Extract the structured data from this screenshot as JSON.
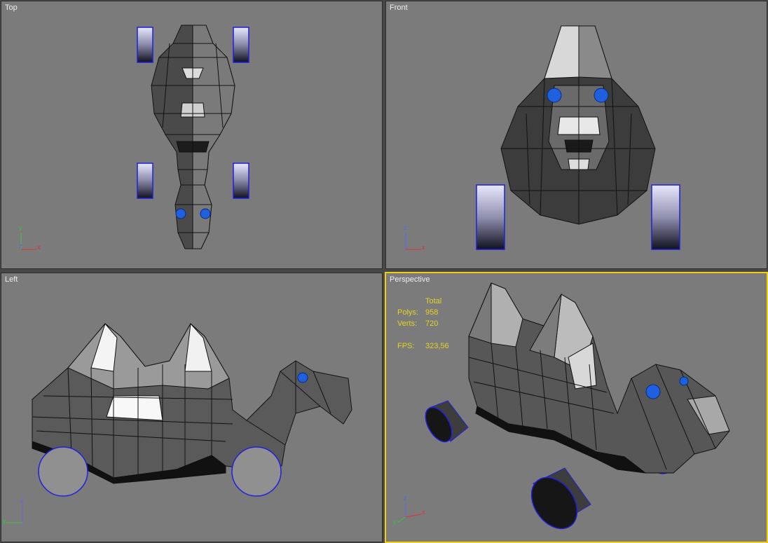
{
  "viewports": {
    "top": {
      "label": "Top"
    },
    "front": {
      "label": "Front"
    },
    "left": {
      "label": "Left"
    },
    "perspective": {
      "label": "Perspective"
    }
  },
  "stats": {
    "header": "Total",
    "polys_label": "Polys:",
    "polys_value": "958",
    "verts_label": "Verts:",
    "verts_value": "720",
    "fps_label": "FPS:",
    "fps_value": "323,56"
  },
  "axes": {
    "top": {
      "v": "y",
      "c": "z",
      "h": "x"
    },
    "front": {
      "v": "z",
      "h": "x"
    },
    "left": {
      "v": "z",
      "h": "y"
    },
    "perspective": {
      "v": "z",
      "h": "x",
      "d": "y"
    }
  },
  "colors": {
    "viewport_bg": "#7b7b7b",
    "active_border": "#f0d010",
    "stats_text": "#e6d31e",
    "axis_x": "#e03030",
    "axis_y": "#40c040",
    "axis_z": "#6060ff",
    "wheel_wire": "#2020dd"
  }
}
